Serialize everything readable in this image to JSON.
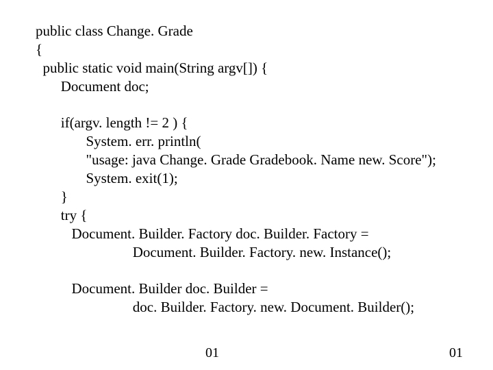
{
  "code": {
    "l1": "public class Change. Grade",
    "l2": "{",
    "l3": "  public static void main(String argv[]) {",
    "l4": "       Document doc;",
    "l5": "",
    "l6": "       if(argv. length != 2 ) {",
    "l7": "              System. err. println(",
    "l8": "              \"usage: java Change. Grade Gradebook. Name new. Score\");",
    "l9": "              System. exit(1);",
    "l10": "       }",
    "l11": "       try {",
    "l12": "          Document. Builder. Factory doc. Builder. Factory =",
    "l13": "                           Document. Builder. Factory. new. Instance();",
    "l14": "",
    "l15": "          Document. Builder doc. Builder =",
    "l16": "                           doc. Builder. Factory. new. Document. Builder();"
  },
  "page": {
    "left": "01",
    "right": "01"
  }
}
